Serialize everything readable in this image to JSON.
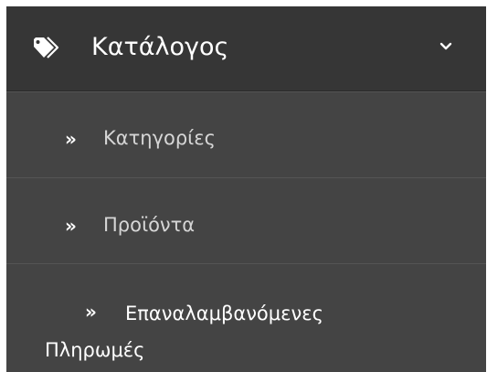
{
  "menu": {
    "header": {
      "label": "Κατάλογος",
      "icon": "tags-icon",
      "toggle_icon": "chevron-down-icon"
    },
    "items": [
      {
        "icon": "double-chevron-right-icon",
        "label": "Κατηγορίες"
      },
      {
        "icon": "double-chevron-right-icon",
        "label": "Προϊόντα"
      },
      {
        "icon": "double-chevron-right-icon",
        "label_line_1": "Επαναλαμβανόμενες",
        "label_line_2": "Πληρωμές"
      }
    ]
  },
  "colors": {
    "header_bg": "#363636",
    "item_bg": "#444444",
    "text": "#ffffff",
    "muted_text": "#d6d6d6"
  }
}
